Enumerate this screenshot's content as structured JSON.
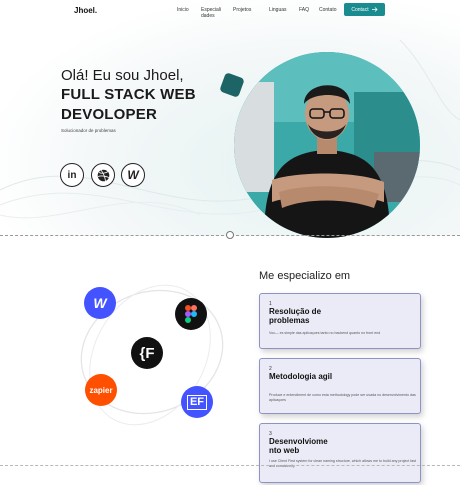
{
  "nav": {
    "logo": "Jhoel.",
    "links": [
      "Inicio",
      "Especiali­dades",
      "Projetos",
      "Linguas",
      "FAQ",
      "Contato"
    ],
    "link_line1": [
      "Inicio",
      "Especiali",
      "Projetos",
      "Linguas",
      "FAQ",
      "Contato"
    ],
    "link_line2": [
      "",
      "dades",
      "",
      "",
      "",
      ""
    ],
    "contact_label": "Contact",
    "contact_icon": "arrow-right-icon"
  },
  "hero": {
    "greeting": "Olá! Eu sou Jhoel,",
    "role_line1": "FULL STACK WEB",
    "role_line2": "DEVOLOPER",
    "subtitle": "Solucionador de problemas",
    "socials": [
      "linkedin-icon",
      "dribbble-icon",
      "webflow-icon"
    ],
    "accent": "#1a8c8f"
  },
  "skills": {
    "title": "Me especializo em",
    "tools": [
      "webflow-icon",
      "figma-icon",
      "framer-icon",
      "zapier-icon",
      "elementor-icon"
    ],
    "zapier_label": "zapier",
    "cards": [
      {
        "number": "1",
        "title": "Resolução de problemas",
        "text": "Voc— es simple das aplicaçoes tanto no backend quanto no front end"
      },
      {
        "number": "2",
        "title": "Metodologia agil",
        "text": "Produce e entendiment de como esta methodology pode ser usada no desenvolvimento das aplicaçoes"
      },
      {
        "number": "3",
        "title": "Desenvolviome nto web",
        "text": "I use Client First system for clean naming structure, which allows me to build any project fast and consistently"
      }
    ]
  }
}
